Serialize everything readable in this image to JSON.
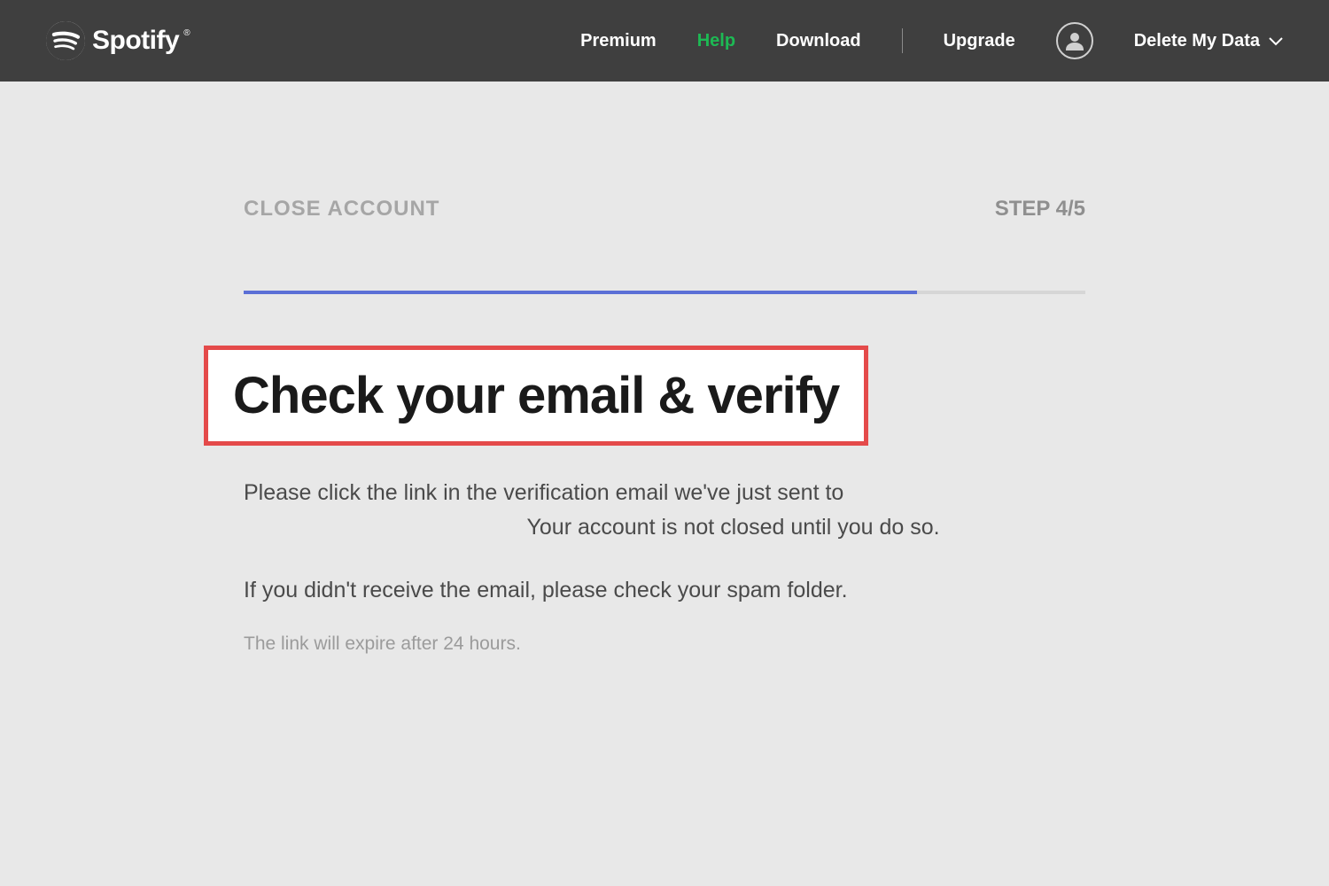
{
  "header": {
    "brand": "Spotify",
    "nav": {
      "premium": "Premium",
      "help": "Help",
      "download": "Download",
      "upgrade": "Upgrade"
    },
    "profile_label": "Delete My Data"
  },
  "main": {
    "breadcrumb": "CLOSE ACCOUNT",
    "step_label": "STEP 4/5",
    "progress_percent": 80,
    "heading": "Check your email & verify",
    "paragraph1a": "Please click the link in the verification email we've just sent to",
    "paragraph1b": "Your account is not closed until you do so.",
    "paragraph2": "If you didn't receive the email, please check your spam folder.",
    "note": "The link will expire after 24 hours."
  }
}
